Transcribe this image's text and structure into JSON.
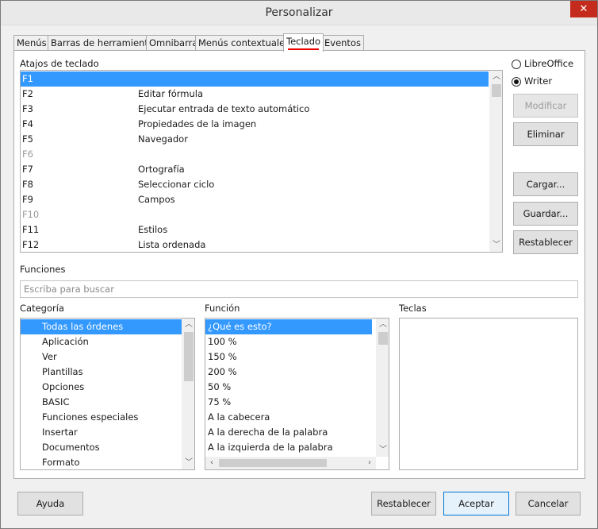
{
  "window": {
    "title": "Personalizar",
    "close_glyph": "✕"
  },
  "tabs": [
    {
      "label": "Menús"
    },
    {
      "label": "Barras de herramientas"
    },
    {
      "label": "Omnibarra"
    },
    {
      "label": "Menús contextuales"
    },
    {
      "label": "Teclado"
    },
    {
      "label": "Eventos"
    }
  ],
  "shortcuts": {
    "label": "Atajos de teclado",
    "rows": [
      {
        "key": "F1",
        "func": ""
      },
      {
        "key": "F2",
        "func": "Editar fórmula"
      },
      {
        "key": "F3",
        "func": "Ejecutar entrada de texto automático"
      },
      {
        "key": "F4",
        "func": "Propiedades de la imagen"
      },
      {
        "key": "F5",
        "func": "Navegador"
      },
      {
        "key": "F6",
        "func": ""
      },
      {
        "key": "F7",
        "func": "Ortografía"
      },
      {
        "key": "F8",
        "func": "Seleccionar ciclo"
      },
      {
        "key": "F9",
        "func": "Campos"
      },
      {
        "key": "F10",
        "func": ""
      },
      {
        "key": "F11",
        "func": "Estilos"
      },
      {
        "key": "F12",
        "func": "Lista ordenada"
      }
    ]
  },
  "scope": {
    "options": [
      {
        "label": "LibreOffice",
        "checked": false
      },
      {
        "label": "Writer",
        "checked": true
      }
    ]
  },
  "side_buttons": {
    "modify": "Modificar",
    "delete": "Eliminar",
    "load": "Cargar...",
    "save": "Guardar...",
    "reset": "Restablecer"
  },
  "functions": {
    "label": "Funciones",
    "search_placeholder": "Escriba para buscar"
  },
  "category": {
    "label": "Categoría",
    "items": [
      "Todas las órdenes",
      "Aplicación",
      "Ver",
      "Plantillas",
      "Opciones",
      "BASIC",
      "Funciones especiales",
      "Insertar",
      "Documentos",
      "Formato"
    ]
  },
  "function": {
    "label": "Función",
    "items": [
      "¿Qué es esto?",
      "100 %",
      "150 %",
      "200 %",
      "50 %",
      "75 %",
      "A la cabecera",
      "A la derecha de la palabra",
      "A la izquierda de la palabra"
    ]
  },
  "keys": {
    "label": "Teclas"
  },
  "footer": {
    "help": "Ayuda",
    "reset": "Restablecer",
    "accept": "Aceptar",
    "cancel": "Cancelar"
  },
  "colors": {
    "selection": "#3399ff",
    "active_tab_underline": "#e00000",
    "close": "#c42b1c"
  }
}
